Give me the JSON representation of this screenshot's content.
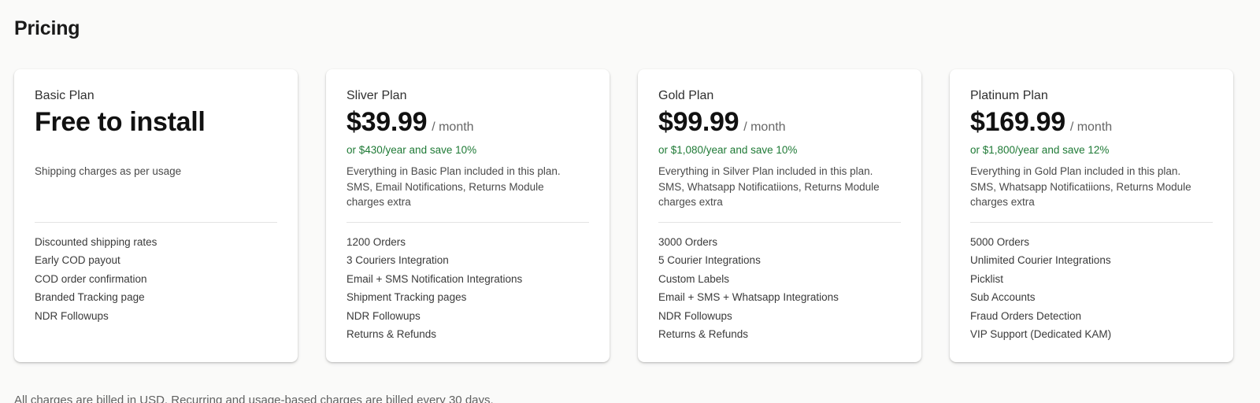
{
  "page": {
    "title": "Pricing",
    "footer_note": "All charges are billed in USD. Recurring and usage-based charges are billed every 30 days."
  },
  "colors": {
    "background": "#fafaf9",
    "card": "#ffffff",
    "savings_green": "#1f7a36",
    "divider": "#e3e3e3"
  },
  "plans": [
    {
      "name": "Basic Plan",
      "price": "Free to install",
      "period": "",
      "savings": "",
      "description": [
        "Shipping charges as per usage"
      ],
      "features": [
        "Discounted shipping rates",
        "Early COD payout",
        "COD order confirmation",
        "Branded Tracking page",
        "NDR Followups"
      ]
    },
    {
      "name": "Sliver Plan",
      "price": "$39.99",
      "period": "/ month",
      "savings": "or $430/year and save 10%",
      "description": [
        "Everything in Basic Plan included in this plan.",
        "SMS, Email Notifications, Returns Module",
        "charges extra"
      ],
      "features": [
        "1200 Orders",
        "3 Couriers Integration",
        "Email + SMS Notification Integrations",
        "Shipment Tracking pages",
        "NDR Followups",
        "Returns & Refunds"
      ]
    },
    {
      "name": "Gold Plan",
      "price": "$99.99",
      "period": "/ month",
      "savings": "or $1,080/year and save 10%",
      "description": [
        "Everything in Silver Plan included in this plan.",
        "SMS, Whatsapp Notificatiions, Returns Module",
        "charges extra"
      ],
      "features": [
        "3000 Orders",
        "5 Courier Integrations",
        "Custom Labels",
        "Email + SMS + Whatsapp Integrations",
        "NDR Followups",
        "Returns & Refunds"
      ]
    },
    {
      "name": "Platinum Plan",
      "price": "$169.99",
      "period": "/ month",
      "savings": "or $1,800/year and save 12%",
      "description": [
        "Everything in Gold Plan included in this plan.",
        "SMS, Whatsapp Notificatiions, Returns Module",
        "charges extra"
      ],
      "features": [
        "5000 Orders",
        "Unlimited Courier Integrations",
        "Picklist",
        "Sub Accounts",
        "Fraud Orders Detection",
        "VIP Support (Dedicated KAM)"
      ]
    }
  ]
}
